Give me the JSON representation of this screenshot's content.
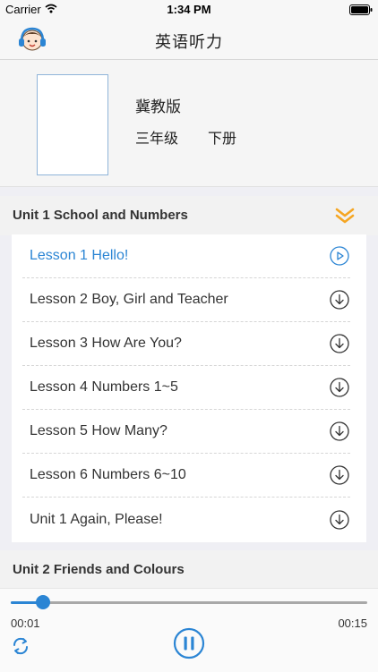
{
  "status_bar": {
    "carrier": "Carrier",
    "time": "1:34 PM"
  },
  "nav": {
    "title": "英语听力",
    "avatar_icon": "child-headphones-avatar-icon"
  },
  "book": {
    "publisher": "冀教版",
    "grade": "三年级",
    "term": "下册"
  },
  "units": [
    {
      "title": "Unit 1 School and Numbers",
      "expanded": true,
      "lessons": [
        {
          "title": "Lesson 1 Hello!",
          "state": "playing",
          "icon": "play-circle-icon"
        },
        {
          "title": "Lesson 2 Boy, Girl and Teacher",
          "state": "download",
          "icon": "download-icon"
        },
        {
          "title": "Lesson 3 How Are You?",
          "state": "download",
          "icon": "download-icon"
        },
        {
          "title": "Lesson 4 Numbers 1~5",
          "state": "download",
          "icon": "download-icon"
        },
        {
          "title": "Lesson 5 How Many?",
          "state": "download",
          "icon": "download-icon"
        },
        {
          "title": "Lesson 6 Numbers 6~10",
          "state": "download",
          "icon": "download-icon"
        },
        {
          "title": "Unit 1 Again, Please!",
          "state": "download",
          "icon": "download-icon"
        }
      ]
    },
    {
      "title": "Unit 2 Friends and Colours",
      "expanded": false
    }
  ],
  "player": {
    "current_time": "00:01",
    "total_time": "00:15",
    "progress": 0.09,
    "state": "playing"
  },
  "colors": {
    "accent": "#2b85d4",
    "chevron": "#f5a623"
  }
}
